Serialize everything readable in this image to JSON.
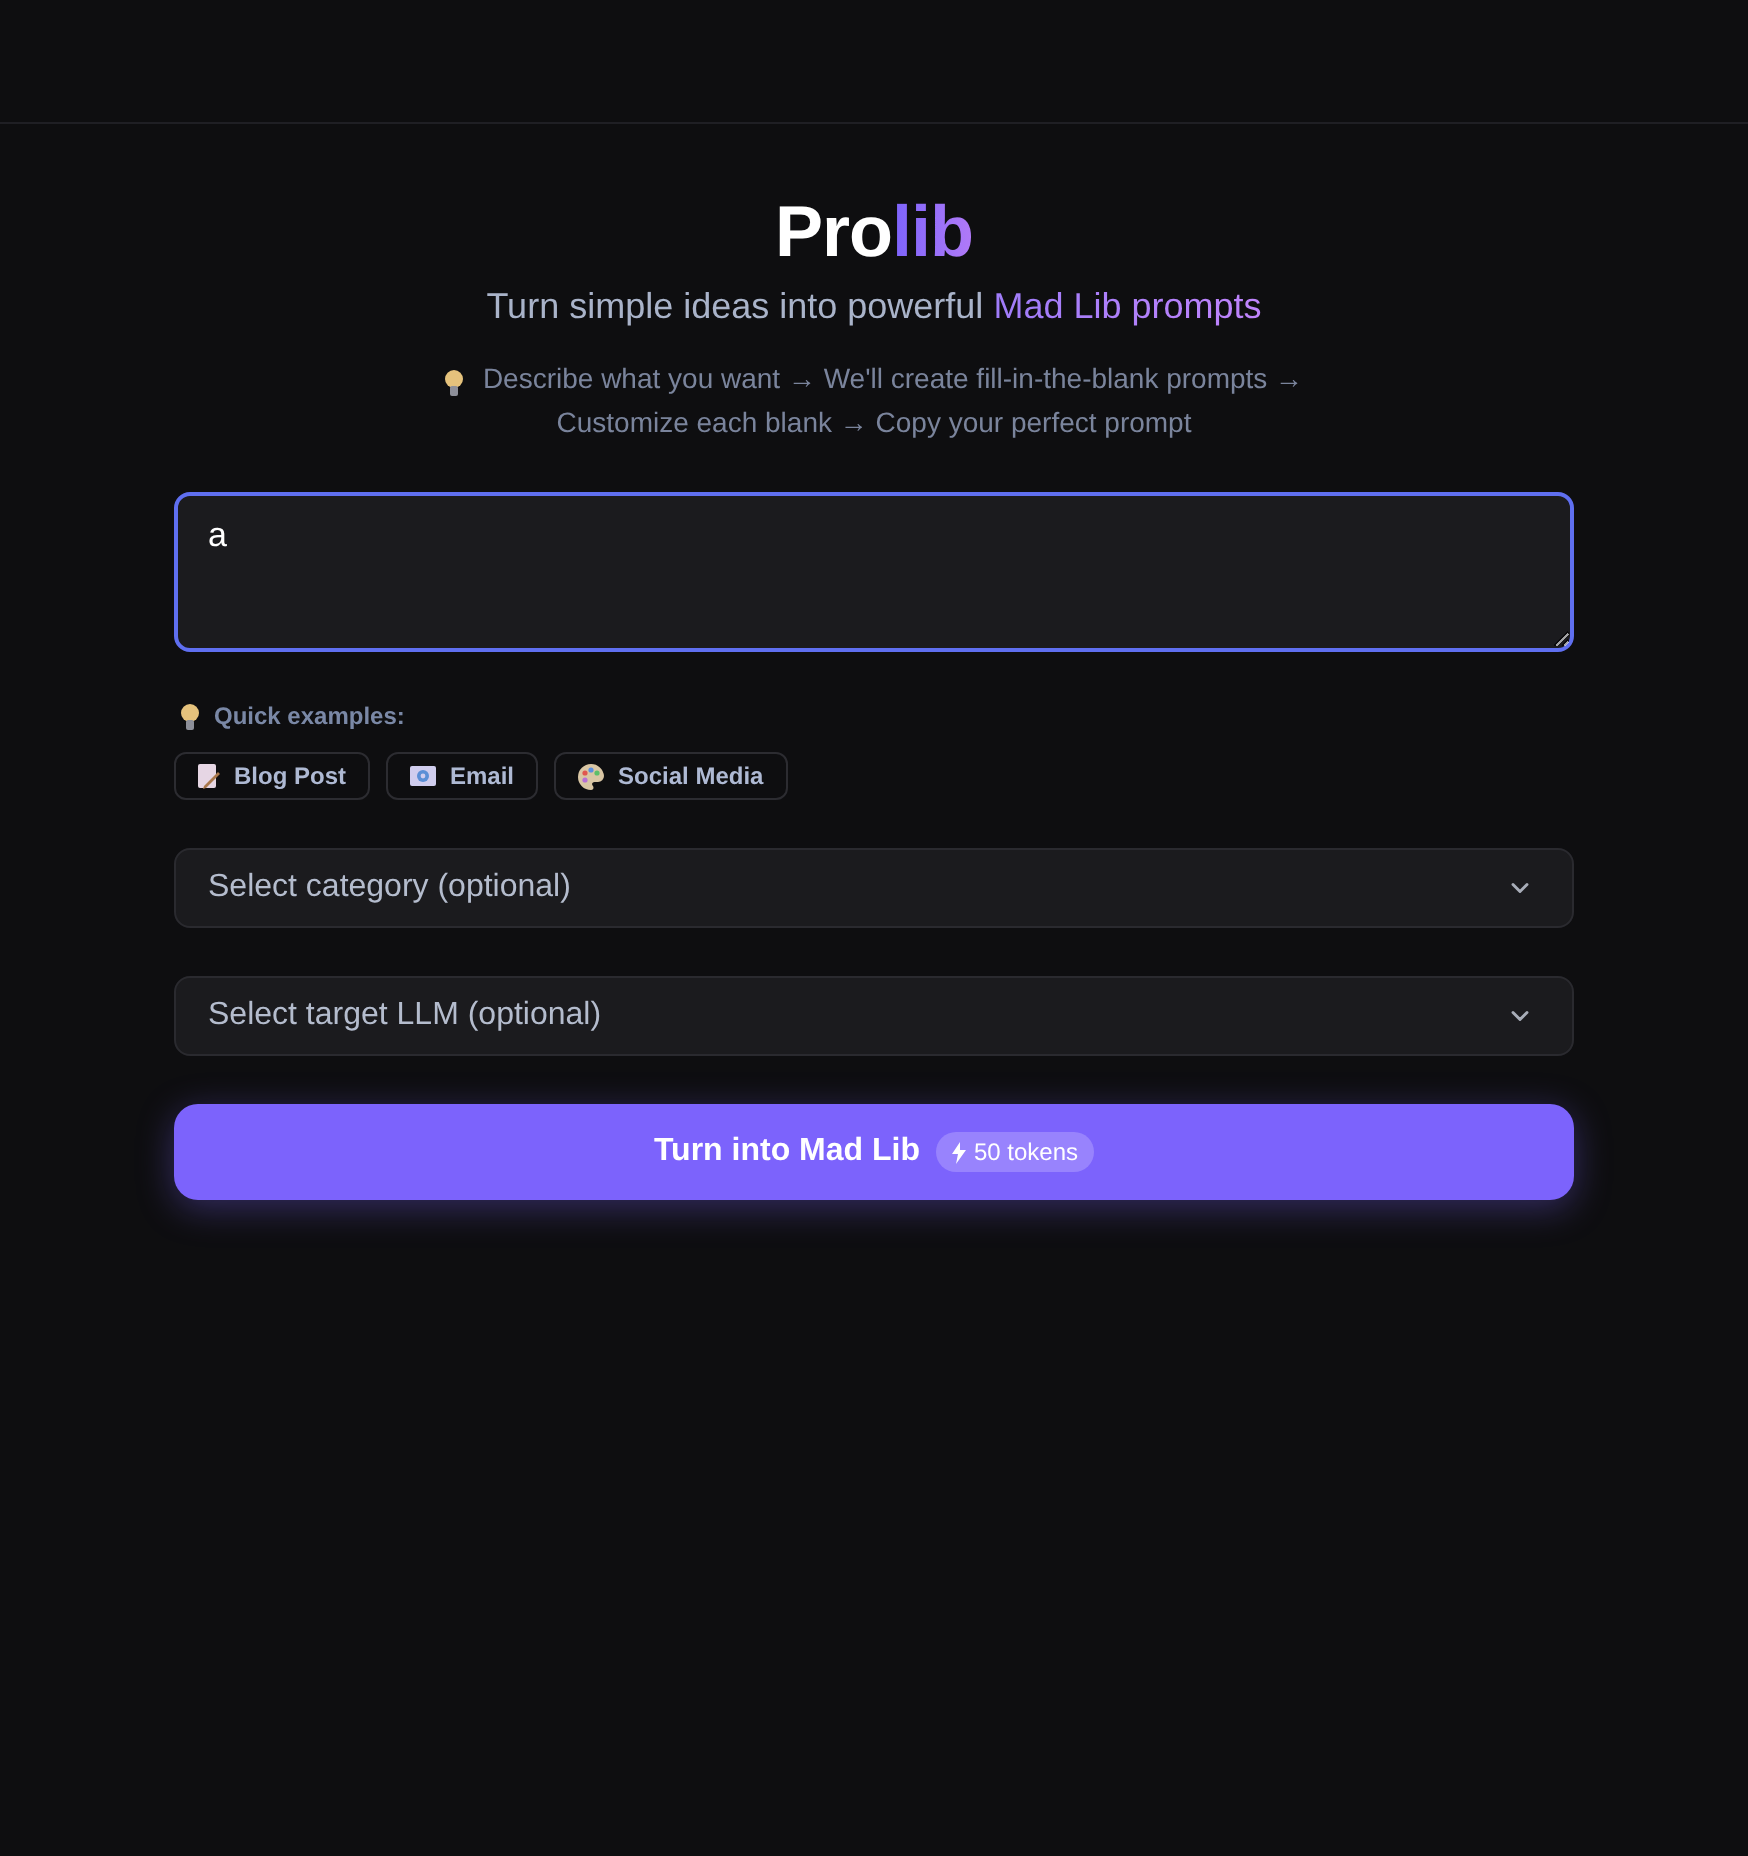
{
  "logo": {
    "lead": "Pro",
    "accent": "lib"
  },
  "tagline": {
    "lead": "Turn simple ideas into powerful",
    "highlight": "Mad Lib prompts"
  },
  "steps": {
    "text": "Describe what you want → We'll create fill-in-the-blank prompts → Customize each blank → Copy your perfect prompt"
  },
  "prompt_input": {
    "value": "a",
    "focused": true
  },
  "quick_examples": {
    "label": "Quick examples:",
    "items": [
      {
        "label": "Blog Post",
        "kind": "document"
      },
      {
        "label": "Email",
        "kind": "envelope"
      },
      {
        "label": "Social Media",
        "kind": "palette"
      }
    ]
  },
  "selects": [
    {
      "placeholder": "Select category (optional)"
    },
    {
      "placeholder": "Select target LLM (optional)"
    }
  ],
  "submit_button": {
    "label": "Turn into Mad Lib",
    "cost": "50 tokens"
  }
}
